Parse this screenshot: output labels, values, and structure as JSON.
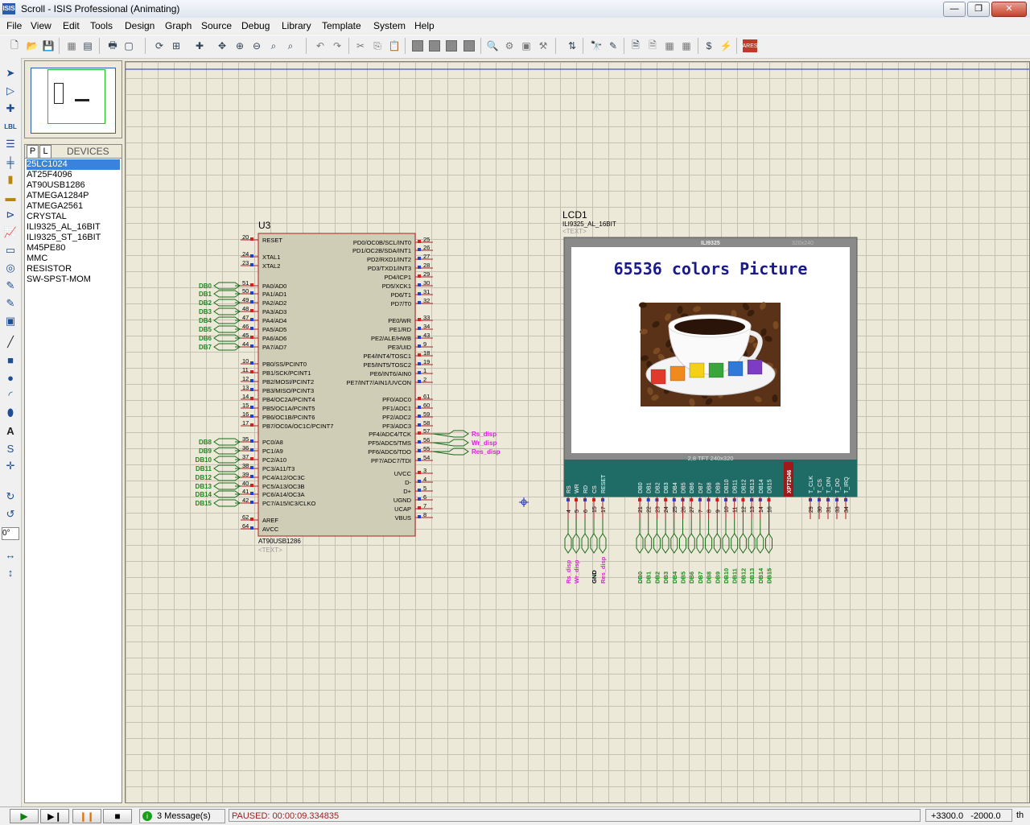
{
  "window": {
    "title": "Scroll - ISIS Professional (Animating)",
    "app_icon": "ISIS"
  },
  "menu": [
    "File",
    "View",
    "Edit",
    "Tools",
    "Design",
    "Graph",
    "Source",
    "Debug",
    "Library",
    "Template",
    "System",
    "Help"
  ],
  "devices": {
    "tab_p": "P",
    "tab_l": "L",
    "title": "DEVICES",
    "items": [
      "25LC1024",
      "AT25F4096",
      "AT90USB1286",
      "ATMEGA1284P",
      "ATMEGA2561",
      "CRYSTAL",
      "ILI9325_AL_16BIT",
      "ILI9325_ST_16BIT",
      "M45PE80",
      "MMC",
      "RESISTOR",
      "SW-SPST-MOM"
    ],
    "selected": "25LC1024"
  },
  "rotation_field": "0°",
  "mcu": {
    "ref": "U3",
    "part": "AT90USB1286",
    "text": "<TEXT>",
    "left_pins": [
      [
        "20",
        "RESET"
      ],
      [
        "24",
        "XTAL1"
      ],
      [
        "23",
        "XTAL2"
      ],
      [
        "51",
        "PA0/AD0"
      ],
      [
        "50",
        "PA1/AD1"
      ],
      [
        "49",
        "PA2/AD2"
      ],
      [
        "48",
        "PA3/AD3"
      ],
      [
        "47",
        "PA4/AD4"
      ],
      [
        "46",
        "PA5/AD5"
      ],
      [
        "45",
        "PA6/AD6"
      ],
      [
        "44",
        "PA7/AD7"
      ],
      [
        "10",
        "PB0/SS/PCINT0"
      ],
      [
        "11",
        "PB1/SCK/PCINT1"
      ],
      [
        "12",
        "PB2/MOSI/PCINT2"
      ],
      [
        "13",
        "PB3/MISO/PCINT3"
      ],
      [
        "14",
        "PB4/OC2A/PCINT4"
      ],
      [
        "15",
        "PB5/OC1A/PCINT5"
      ],
      [
        "16",
        "PB6/OC1B/PCINT6"
      ],
      [
        "17",
        "PB7/OC0A/OC1C/PCINT7"
      ],
      [
        "35",
        "PC0/A8"
      ],
      [
        "36",
        "PC1/A9"
      ],
      [
        "37",
        "PC2/A10"
      ],
      [
        "38",
        "PC3/A11/T3"
      ],
      [
        "39",
        "PC4/A12/OC3C"
      ],
      [
        "40",
        "PC5/A13/OC3B"
      ],
      [
        "41",
        "PC6/A14/OC3A"
      ],
      [
        "42",
        "PC7/A15/IC3/CLKO"
      ],
      [
        "62",
        "AREF"
      ],
      [
        "64",
        "AVCC"
      ]
    ],
    "right_pins": [
      [
        "25",
        "PD0/OC0B/SCL/INT0"
      ],
      [
        "26",
        "PD1/OC2B/SDA/INT1"
      ],
      [
        "27",
        "PD2/RXD1/INT2"
      ],
      [
        "28",
        "PD3/TXD1/INT3"
      ],
      [
        "29",
        "PD4/ICP1"
      ],
      [
        "30",
        "PD5/XCK1"
      ],
      [
        "31",
        "PD6/T1"
      ],
      [
        "32",
        "PD7/T0"
      ],
      [
        "33",
        "PE0/WR"
      ],
      [
        "34",
        "PE1/RD"
      ],
      [
        "43",
        "PE2/ALE/HWB"
      ],
      [
        "9",
        "PE3/UID"
      ],
      [
        "18",
        "PE4/INT4/TOSC1"
      ],
      [
        "19",
        "PE5/INT5/TOSC2"
      ],
      [
        "1",
        "PE6/INT6/AIN0"
      ],
      [
        "2",
        "PE7/INT7/AIN1/UVCON"
      ],
      [
        "61",
        "PF0/ADC0"
      ],
      [
        "60",
        "PF1/ADC1"
      ],
      [
        "59",
        "PF2/ADC2"
      ],
      [
        "58",
        "PF3/ADC3"
      ],
      [
        "57",
        "PF4/ADC4/TCK"
      ],
      [
        "56",
        "PF5/ADC5/TMS"
      ],
      [
        "55",
        "PF6/ADC6/TDO"
      ],
      [
        "54",
        "PF7/ADC7/TDI"
      ],
      [
        "3",
        "UVCC"
      ],
      [
        "4",
        "D-"
      ],
      [
        "5",
        "D+"
      ],
      [
        "6",
        "UGND"
      ],
      [
        "7",
        "UCAP"
      ],
      [
        "8",
        "VBUS"
      ]
    ],
    "porta_labels": [
      "DB0",
      "DB1",
      "DB2",
      "DB3",
      "DB4",
      "DB5",
      "DB6",
      "DB7"
    ],
    "portc_labels": [
      "DB8",
      "DB9",
      "DB10",
      "DB11",
      "DB12",
      "DB13",
      "DB14",
      "DB15"
    ],
    "portf_labels": [
      "Rs_disp",
      "Wr_disp",
      "Res_disp"
    ]
  },
  "lcd": {
    "ref": "LCD1",
    "part": "ILI9325_AL_16BIT",
    "text": "<TEXT>",
    "controller": "ILI9325",
    "resolution": "320x240",
    "caption": "65536 colors Picture",
    "board_label": "2,8 TFT 240x320",
    "touch_chip": "XPT2046",
    "ctrl_pins": [
      [
        "4",
        "RS"
      ],
      [
        "5",
        "WR"
      ],
      [
        "6",
        "RD"
      ],
      [
        "15",
        "CS"
      ],
      [
        "17",
        "RESET"
      ]
    ],
    "data_pins": [
      [
        "21",
        "DB0"
      ],
      [
        "22",
        "DB1"
      ],
      [
        "23",
        "DB2"
      ],
      [
        "24",
        "DB3"
      ],
      [
        "25",
        "DB4"
      ],
      [
        "26",
        "DB5"
      ],
      [
        "27",
        "DB6"
      ],
      [
        "7",
        "DB7"
      ],
      [
        "8",
        "DB8"
      ],
      [
        "9",
        "DB9"
      ],
      [
        "10",
        "DB10"
      ],
      [
        "11",
        "DB11"
      ],
      [
        "12",
        "DB12"
      ],
      [
        "13",
        "DB13"
      ],
      [
        "14",
        "DB14"
      ],
      [
        "16",
        "DB15"
      ]
    ],
    "touch_pins": [
      [
        "29",
        "T_CLK"
      ],
      [
        "30",
        "T_CS"
      ],
      [
        "31",
        "T_DIN"
      ],
      [
        "33",
        "T_DO"
      ],
      [
        "34",
        "T_IRQ"
      ]
    ],
    "bottom_ctrl_labels": [
      "Rs_disp",
      "Wr_disp",
      "",
      "GND",
      "Res_disp"
    ],
    "bottom_data_labels": [
      "DB0",
      "DB1",
      "DB2",
      "DB3",
      "DB4",
      "DB5",
      "DB6",
      "DB7",
      "DB8",
      "DB9",
      "DB10",
      "DB11",
      "DB12",
      "DB13",
      "DB14",
      "DB15"
    ]
  },
  "status": {
    "messages": "3 Message(s)",
    "state": "PAUSED: 00:00:09.334835",
    "coord_x": "+3300.0",
    "coord_y": "-2000.0",
    "units": "th"
  },
  "colors": {
    "net_label_green": "#1a8a1a",
    "net_label_magenta": "#e020e0",
    "pcb_teal": "#1f6b66",
    "lcd_caption": "#1a1a8a"
  }
}
